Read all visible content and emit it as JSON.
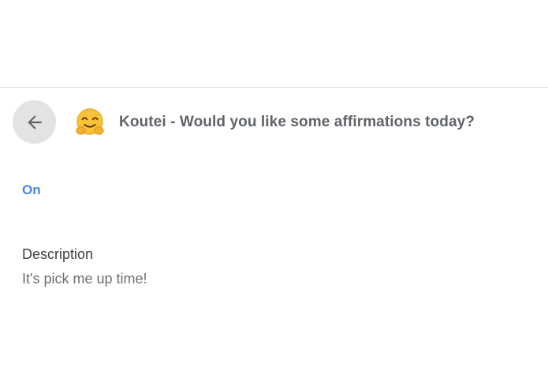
{
  "header": {
    "title": "Koutei - Would you like some affirmations today?",
    "back_icon": "arrow-left-icon",
    "emoji_icon": "hugging-face-emoji-icon"
  },
  "status": {
    "label": "On",
    "color": "#4a86e0"
  },
  "description": {
    "label": "Description",
    "value": "It's pick me up time!"
  }
}
